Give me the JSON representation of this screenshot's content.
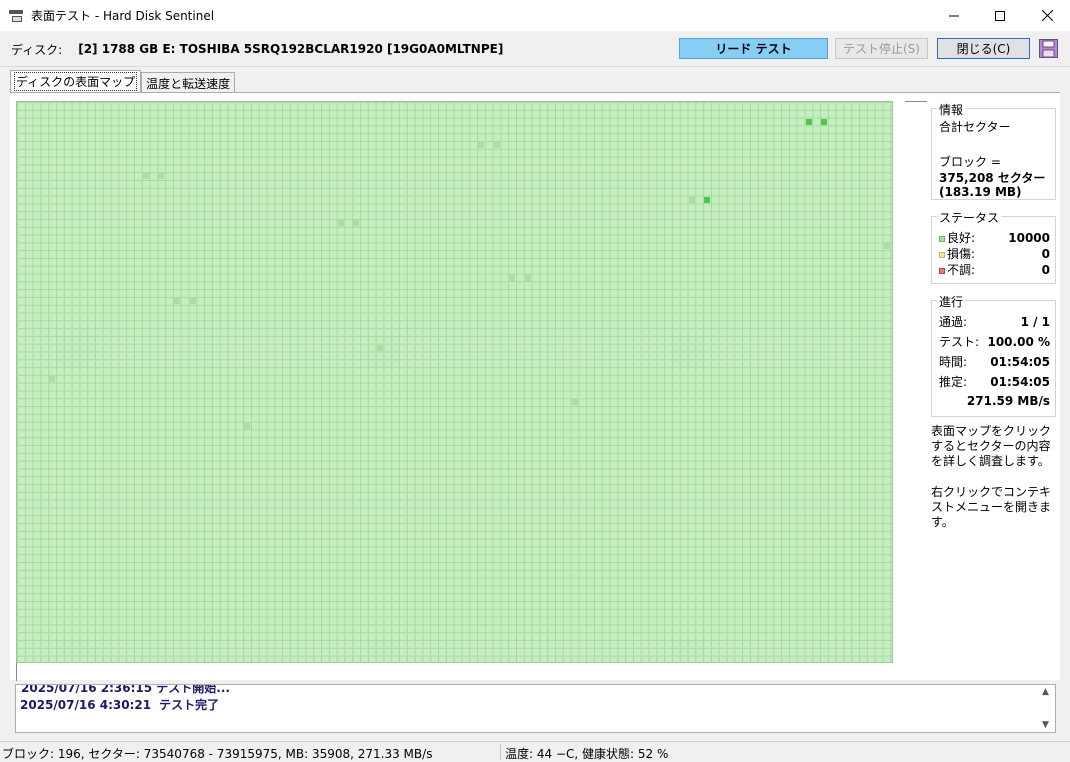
{
  "window": {
    "title": "表面テスト - Hard Disk Sentinel",
    "minimize": "─",
    "maximize": "□",
    "close": "✕"
  },
  "disk": {
    "label": "ディスク:",
    "name": "[2] 1788 GB E: TOSHIBA 5SRQ192BCLAR1920 [19G0A0MLTNPE]"
  },
  "toolbar": {
    "read_test": "リード テスト",
    "stop_test": "テスト停止(S)",
    "close": "閉じる(C)",
    "save_icon": "save-icon"
  },
  "tabs": [
    {
      "label": "ディスクの表面マップ",
      "active": true
    },
    {
      "label": "温度と転送速度",
      "active": false
    }
  ],
  "surface_map": {
    "colors": {
      "good": "#c6eec0",
      "good_dark": "#a9e0a2",
      "good_darker": "#4fc84a",
      "damaged": "#e8e0a0",
      "bad": "#e08080"
    }
  },
  "info": {
    "title": "情報",
    "total_sectors": "合計セクター",
    "block_label": "ブロック =",
    "block_sectors": "375,208 セクター",
    "block_size": "(183.19 MB)"
  },
  "status": {
    "title": "ステータス",
    "items": [
      {
        "label": "良好:",
        "value": "10000",
        "color": "#a9e0a2",
        "border": "#6ab864"
      },
      {
        "label": "損傷:",
        "value": "0",
        "color": "#f0e8b0",
        "border": "#c8b860"
      },
      {
        "label": "不調:",
        "value": "0",
        "color": "#e08080",
        "border": "#c04040"
      }
    ]
  },
  "progress": {
    "title": "進行",
    "pass_label": "通過:",
    "pass_value": "1 / 1",
    "test_label": "テスト:",
    "test_value": "100.00 %",
    "time_label": "時間:",
    "time_value": "01:54:05",
    "estimate_label": "推定:",
    "estimate_value": "01:54:05",
    "speed": "271.59 MB/s"
  },
  "hints": {
    "click": "表面マップをクリックするとセクターの内容を詳しく調査します。",
    "right_click": "右クリックでコンテキストメニューを開きます。"
  },
  "log": {
    "lines": [
      {
        "time": "2025/07/16  4:30:21",
        "message": "テスト完了"
      }
    ]
  },
  "statusbar": {
    "left": "ブロック: 196, セクター: 73540768 - 73915975, MB: 35908, 271.33 MB/s",
    "right": "温度: 44 −C, 健康状態: 52 %"
  }
}
